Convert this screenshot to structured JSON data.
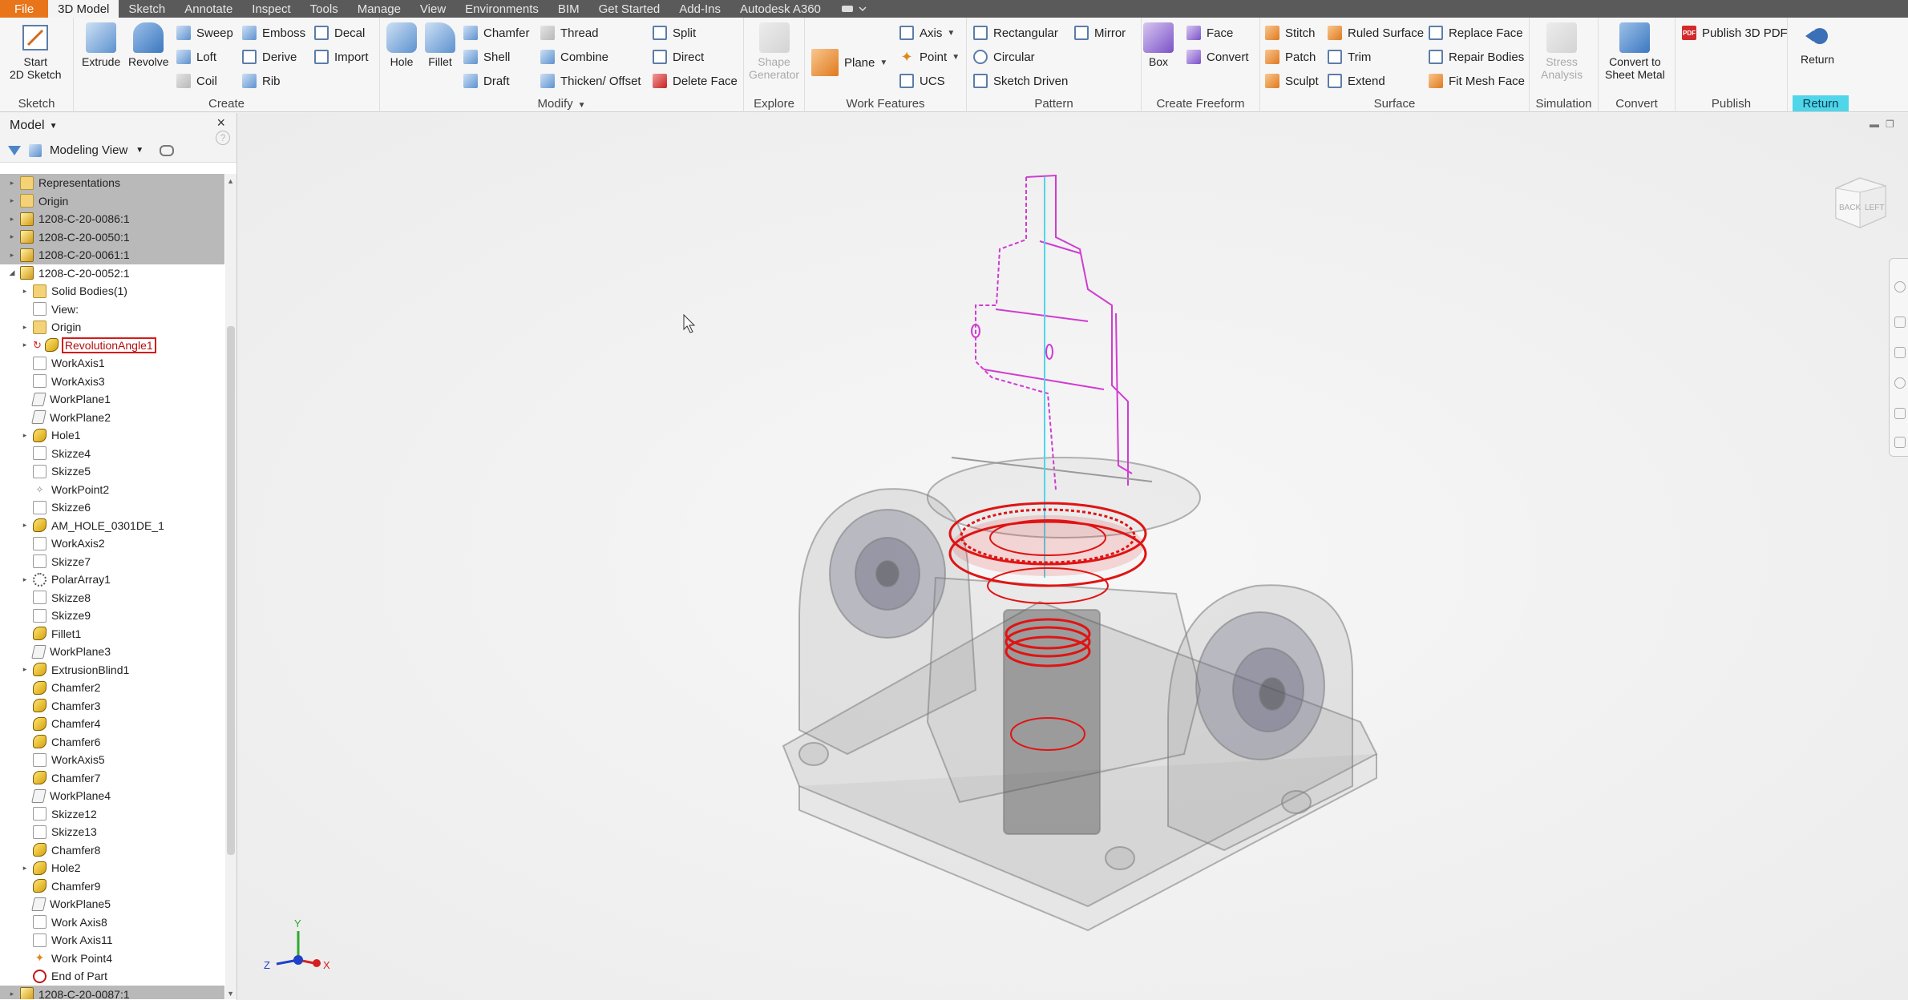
{
  "menu_tabs": [
    {
      "label": "File"
    },
    {
      "label": "3D Model"
    },
    {
      "label": "Sketch"
    },
    {
      "label": "Annotate"
    },
    {
      "label": "Inspect"
    },
    {
      "label": "Tools"
    },
    {
      "label": "Manage"
    },
    {
      "label": "View"
    },
    {
      "label": "Environments"
    },
    {
      "label": "BIM"
    },
    {
      "label": "Get Started"
    },
    {
      "label": "Add-Ins"
    },
    {
      "label": "Autodesk A360"
    }
  ],
  "ribbon": {
    "sketch": {
      "label": "Sketch",
      "start_2d_line1": "Start",
      "start_2d_line2": "2D Sketch"
    },
    "create": {
      "label": "Create",
      "extrude": "Extrude",
      "revolve": "Revolve",
      "sweep": "Sweep",
      "loft": "Loft",
      "coil": "Coil",
      "emboss": "Emboss",
      "derive": "Derive",
      "rib": "Rib",
      "decal": "Decal",
      "import": "Import"
    },
    "modify": {
      "label": "Modify",
      "hole": "Hole",
      "fillet": "Fillet",
      "chamfer": "Chamfer",
      "shell": "Shell",
      "draft": "Draft",
      "thread": "Thread",
      "combine": "Combine",
      "thicken": "Thicken/ Offset",
      "split": "Split",
      "direct": "Direct",
      "delete_face": "Delete Face"
    },
    "explore": {
      "label": "Explore",
      "shape_gen_line1": "Shape",
      "shape_gen_line2": "Generator"
    },
    "work_features": {
      "label": "Work Features",
      "plane": "Plane",
      "axis": "Axis",
      "point": "Point",
      "ucs": "UCS"
    },
    "pattern": {
      "label": "Pattern",
      "rectangular": "Rectangular",
      "circular": "Circular",
      "sketch_driven": "Sketch Driven",
      "mirror": "Mirror"
    },
    "create_freeform": {
      "label": "Create Freeform",
      "box": "Box",
      "face": "Face",
      "convert": "Convert"
    },
    "surface": {
      "label": "Surface",
      "stitch": "Stitch",
      "patch": "Patch",
      "sculpt": "Sculpt",
      "ruled_surface": "Ruled Surface",
      "trim": "Trim",
      "extend": "Extend",
      "replace_face": "Replace Face",
      "repair_bodies": "Repair Bodies",
      "fit_mesh_face": "Fit Mesh Face"
    },
    "simulation": {
      "label": "Simulation",
      "stress_line1": "Stress",
      "stress_line2": "Analysis"
    },
    "convert": {
      "label": "Convert",
      "sheet_metal_line1": "Convert to",
      "sheet_metal_line2": "Sheet Metal"
    },
    "publish": {
      "label": "Publish",
      "publish_3d_pdf": "Publish 3D PDF",
      "pdf_badge": "PDF"
    },
    "return": {
      "label": "Return",
      "button": "Return"
    }
  },
  "browser": {
    "title": "Model",
    "close": "×",
    "help": "?",
    "view_name": "Modeling View",
    "tree": [
      {
        "label": "Representations",
        "icon": "folder",
        "expand": "▸",
        "selected": true
      },
      {
        "label": "Origin",
        "icon": "folder",
        "expand": "▸",
        "selected": true
      },
      {
        "label": "1208-C-20-0086:1",
        "icon": "asm",
        "expand": "▸",
        "selected": true
      },
      {
        "label": "1208-C-20-0050:1",
        "icon": "asm",
        "expand": "▸",
        "selected": true
      },
      {
        "label": "1208-C-20-0061:1",
        "icon": "asm",
        "expand": "▸",
        "selected": true
      },
      {
        "label": "1208-C-20-0052:1",
        "icon": "asm",
        "expand": "◢"
      },
      {
        "label": "Solid Bodies(1)",
        "icon": "folder",
        "expand": "▸",
        "indent": 1
      },
      {
        "label": "View:",
        "icon": "sheet",
        "expand": "",
        "indent": 1
      },
      {
        "label": "Origin",
        "icon": "folder",
        "expand": "▸",
        "indent": 1
      },
      {
        "label": "RevolutionAngle1",
        "icon": "feat",
        "expand": "▸",
        "indent": 1,
        "error": true
      },
      {
        "label": "WorkAxis1",
        "icon": "sheet",
        "expand": "",
        "indent": 1
      },
      {
        "label": "WorkAxis3",
        "icon": "sheet",
        "expand": "",
        "indent": 1
      },
      {
        "label": "WorkPlane1",
        "icon": "plane",
        "expand": "",
        "indent": 1
      },
      {
        "label": "WorkPlane2",
        "icon": "plane",
        "expand": "",
        "indent": 1
      },
      {
        "label": "Hole1",
        "icon": "feat",
        "expand": "▸",
        "indent": 1
      },
      {
        "label": "Skizze4",
        "icon": "sheet",
        "expand": "",
        "indent": 1
      },
      {
        "label": "Skizze5",
        "icon": "sheet",
        "expand": "",
        "indent": 1
      },
      {
        "label": "WorkPoint2",
        "icon": "point",
        "expand": "",
        "indent": 1
      },
      {
        "label": "Skizze6",
        "icon": "sheet",
        "expand": "",
        "indent": 1
      },
      {
        "label": "AM_HOLE_0301DE_1",
        "icon": "feat",
        "expand": "▸",
        "indent": 1
      },
      {
        "label": "WorkAxis2",
        "icon": "sheet",
        "expand": "",
        "indent": 1
      },
      {
        "label": "Skizze7",
        "icon": "sheet",
        "expand": "",
        "indent": 1
      },
      {
        "label": "PolarArray1",
        "icon": "pattern",
        "expand": "▸",
        "indent": 1
      },
      {
        "label": "Skizze8",
        "icon": "sheet",
        "expand": "",
        "indent": 1
      },
      {
        "label": "Skizze9",
        "icon": "sheet",
        "expand": "",
        "indent": 1
      },
      {
        "label": "Fillet1",
        "icon": "feat",
        "expand": "",
        "indent": 1
      },
      {
        "label": "WorkPlane3",
        "icon": "plane",
        "expand": "",
        "indent": 1
      },
      {
        "label": "ExtrusionBlind1",
        "icon": "feat",
        "expand": "▸",
        "indent": 1
      },
      {
        "label": "Chamfer2",
        "icon": "feat",
        "expand": "",
        "indent": 1
      },
      {
        "label": "Chamfer3",
        "icon": "feat",
        "expand": "",
        "indent": 1
      },
      {
        "label": "Chamfer4",
        "icon": "feat",
        "expand": "",
        "indent": 1
      },
      {
        "label": "Chamfer6",
        "icon": "feat",
        "expand": "",
        "indent": 1
      },
      {
        "label": "WorkAxis5",
        "icon": "sheet",
        "expand": "",
        "indent": 1
      },
      {
        "label": "Chamfer7",
        "icon": "feat",
        "expand": "",
        "indent": 1
      },
      {
        "label": "WorkPlane4",
        "icon": "plane",
        "expand": "",
        "indent": 1
      },
      {
        "label": "Skizze12",
        "icon": "sheet",
        "expand": "",
        "indent": 1
      },
      {
        "label": "Skizze13",
        "icon": "sheet",
        "expand": "",
        "indent": 1
      },
      {
        "label": "Chamfer8",
        "icon": "feat",
        "expand": "",
        "indent": 1
      },
      {
        "label": "Hole2",
        "icon": "feat",
        "expand": "▸",
        "indent": 1
      },
      {
        "label": "Chamfer9",
        "icon": "feat",
        "expand": "",
        "indent": 1
      },
      {
        "label": "WorkPlane5",
        "icon": "plane",
        "expand": "",
        "indent": 1
      },
      {
        "label": "Work Axis8",
        "icon": "sheet",
        "expand": "",
        "indent": 1
      },
      {
        "label": "Work Axis11",
        "icon": "sheet",
        "expand": "",
        "indent": 1
      },
      {
        "label": "Work Point4",
        "icon": "workpt",
        "expand": "",
        "indent": 1
      },
      {
        "label": "End of Part",
        "icon": "end",
        "expand": "",
        "indent": 1
      },
      {
        "label": "1208-C-20-0087:1",
        "icon": "asm",
        "expand": "▸",
        "selected": true
      }
    ]
  },
  "viewport": {
    "triad": {
      "x": "X",
      "y": "Y",
      "z": "Z"
    },
    "viewcube": {
      "back": "BACK",
      "left": "LEFT"
    }
  },
  "colors": {
    "file_tab": "#e8751a",
    "return_highlight": "#4fd6ea",
    "selection_red": "#e01414",
    "sketch_magenta": "#d13bd1"
  }
}
